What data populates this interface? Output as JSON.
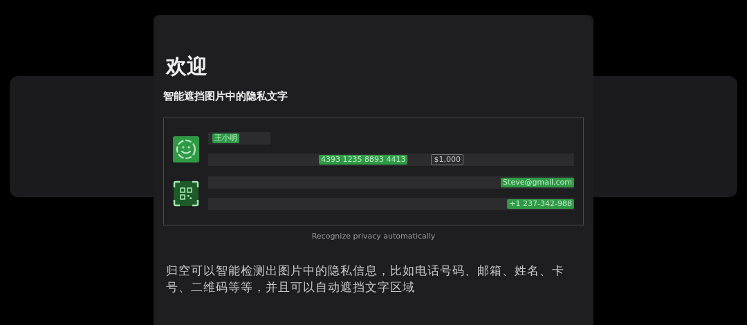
{
  "dialog": {
    "title": "欢迎",
    "subtitle": "智能遮挡图片中的隐私文字",
    "demo": {
      "groups": [
        {
          "rows": [
            {
              "chips": [
                {
                  "text": "王小明",
                  "masked": true
                }
              ]
            },
            {
              "chips": [
                {
                  "text": "4393 1235 8893 4413",
                  "masked": true
                },
                {
                  "text": "$1,000",
                  "masked": false
                }
              ]
            }
          ]
        },
        {
          "rows": [
            {
              "chips": [
                {
                  "text": "Steve@gmail.com",
                  "masked": true
                }
              ]
            },
            {
              "chips": [
                {
                  "text": "+1 237-342-988",
                  "masked": true
                }
              ]
            }
          ]
        }
      ],
      "caption": "Recognize privacy automatically"
    },
    "description": "归空可以智能检测出图片中的隐私信息，比如电话号码、邮箱、姓名、卡号、二维码等等，并且可以自动遮挡文字区域"
  }
}
